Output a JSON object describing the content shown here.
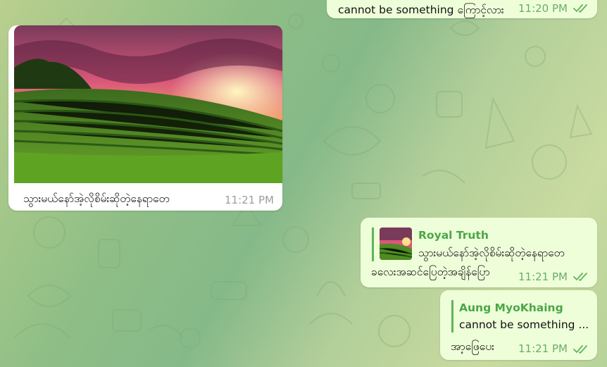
{
  "messages": {
    "top": {
      "text": "cannot be something ကြောင့်လား",
      "time": "11:20 PM"
    },
    "photo": {
      "caption": "သွားမယ်နော်အဲ့လိုစိမ်းဆိုတဲ့နေရာတေ",
      "time": "11:21 PM"
    },
    "reply1": {
      "reply_name": "Royal Truth",
      "reply_text": "သွားမယ်နော်အဲ့လိုစိမ်းဆိုတဲ့နေရာတေ",
      "text": "ခလေးအဆင်ပြေတဲ့အချိန်ပြော",
      "time": "11:21 PM"
    },
    "reply2": {
      "reply_name": "Aung MyoKhaing",
      "reply_text": "cannot be something ...",
      "text": "အာ့ဖြေပေး",
      "time": "11:21 PM"
    }
  },
  "colors": {
    "outgoing_bubble": "#eefed9",
    "incoming_bubble": "#ffffff",
    "accent": "#4aa746"
  },
  "icons": [
    "double-check-icon",
    "vineyard-photo",
    "reply-thumbnail"
  ]
}
